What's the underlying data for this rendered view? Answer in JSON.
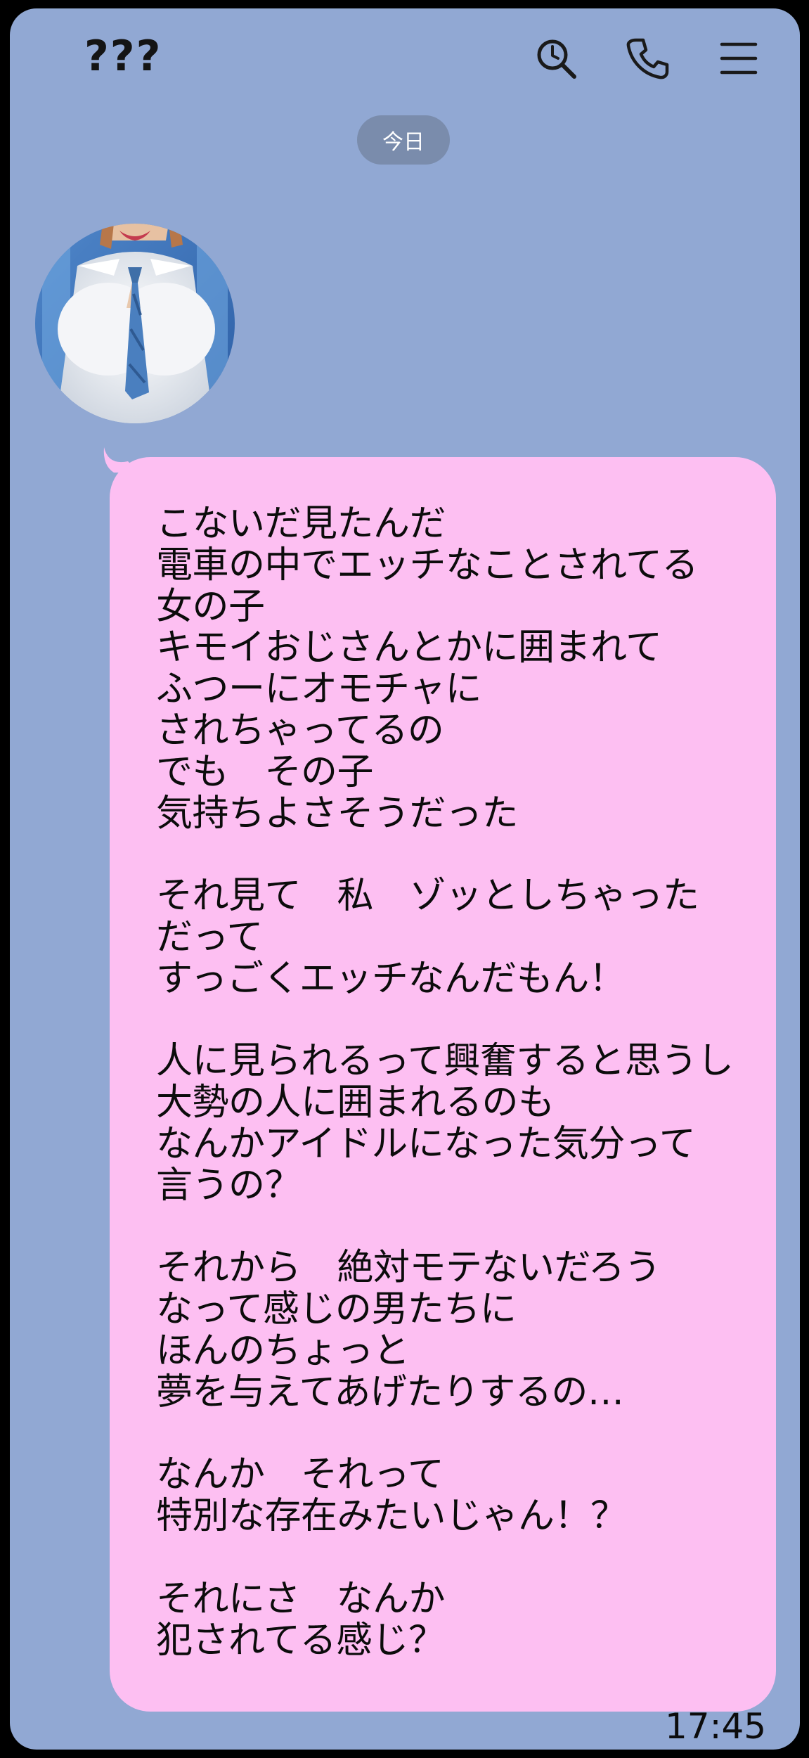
{
  "colors": {
    "background": "#91a8d3",
    "bezel": "#000000",
    "bubble": "#fdbff2",
    "date_pill": "#7a8cac",
    "text": "#0c0c0c",
    "icon": "#1a1a1a"
  },
  "header": {
    "title": "???",
    "icons": [
      "search-icon",
      "phone-icon",
      "menu-icon"
    ]
  },
  "date_divider": "今日",
  "message": {
    "avatar": "avatar-image",
    "lines": [
      "こないだ見たんだ",
      "電車の中でエッチなことされてる",
      "女の子",
      "キモイおじさんとかに囲まれて",
      "ふつーにオモチャに",
      "されちゃってるの",
      "でも　その子",
      "気持ちよさそうだった",
      "",
      "それ見て　私　ゾッとしちゃった",
      "だって",
      "すっごくエッチなんだもん！",
      "",
      "人に見られるって興奮すると思うし",
      "大勢の人に囲まれるのも",
      "なんかアイドルになった気分って",
      "言うの？",
      "",
      "それから　絶対モテないだろう",
      "なって感じの男たちに",
      "ほんのちょっと",
      "夢を与えてあげたりするの…",
      "",
      "なんか　それって",
      "特別な存在みたいじゃん！？",
      "",
      "それにさ　なんか",
      "犯されてる感じ？"
    ],
    "time": "17:45"
  }
}
